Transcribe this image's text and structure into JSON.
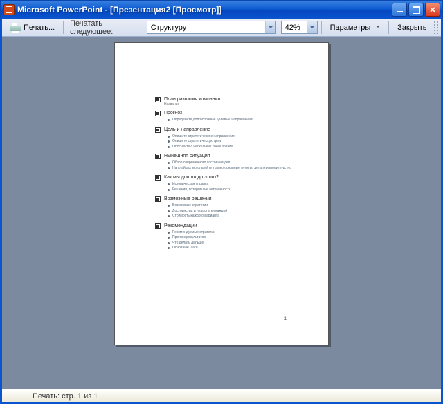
{
  "window": {
    "title": "Microsoft PowerPoint - [Презентация2 [Просмотр]]"
  },
  "toolbar": {
    "print_label": "Печать...",
    "print_next_label": "Печатать следующее:",
    "what_value": "Структуру",
    "zoom_value": "42%",
    "options_label": "Параметры",
    "close_label": "Закрыть"
  },
  "page": {
    "number": "1",
    "outline": [
      {
        "title": "План развития компании",
        "subtitle": "Название",
        "bullets": []
      },
      {
        "title": "Прогноз",
        "bullets": [
          "Определите долгосрочные целевые направления"
        ]
      },
      {
        "title": "Цель и направление",
        "bullets": [
          "Опишите стратегическое направление",
          "Опишите стратегическую цель",
          "Обоснуйте с нескольких точек зрения"
        ]
      },
      {
        "title": "Нынешняя ситуация",
        "bullets": [
          "Обзор современного состояния дел",
          "На слайдах используйте только основные пункты, детали изложите устно"
        ]
      },
      {
        "title": "Как мы дошли до этого?",
        "bullets": [
          "Историческая справка",
          "Решения, потерявшие актуальность"
        ]
      },
      {
        "title": "Возможные решения",
        "bullets": [
          "Возможные стратегии",
          "Достоинства и недостатки каждой",
          "Стоимость каждого варианта"
        ]
      },
      {
        "title": "Рекомендации",
        "bullets": [
          "Рекомендуемые стратегии",
          "Прогноз результатов",
          "Что делать дальше",
          "Основные шаги"
        ]
      }
    ]
  },
  "statusbar": {
    "text": "Печать: стр. 1 из 1"
  }
}
